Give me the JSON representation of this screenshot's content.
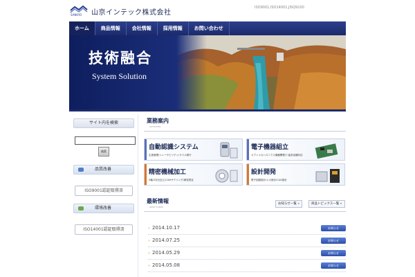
{
  "header": {
    "logo_text": "SANKYO",
    "company": "山京インテック株式会社",
    "iso": "ISO9001,ISO14001,JISQ9100"
  },
  "nav": [
    "ホーム",
    "商品情報",
    "会社情報",
    "採用情報",
    "お問い合わせ"
  ],
  "hero": {
    "title": "技術融合",
    "subtitle": "System Solution"
  },
  "sidebar": {
    "search_label": "サイト内を検索",
    "search_button": "検索",
    "quality_head": "品質改善",
    "quality_btn": "ISO9001認証取得済",
    "env_head": "環境改善",
    "env_btn": "ISO14001認証取得済"
  },
  "business": {
    "title": "業務案内",
    "title_en": "ACTIVITIES",
    "cards": [
      {
        "title": "自動認識システム",
        "sub": "生産管理/トレーサビリティ/ラベル発行",
        "accent": "#5a6fb8"
      },
      {
        "title": "電子機器組立",
        "sub": "オプトメカトロニクス機器開発/少量多品種対応",
        "accent": "#5a6fb8"
      },
      {
        "title": "精密機械加工",
        "sub": "5軸/3次元加工/CAMサテリング/精密測定",
        "accent": "#d9772b"
      },
      {
        "title": "設計開発",
        "sub": "電子回路設計/メカ設計/CAD設計",
        "accent": "#d9772b"
      }
    ]
  },
  "news": {
    "title": "最新情報",
    "title_en": "WHAT'S NEW",
    "btn_notice": "お知らせ一覧 »",
    "btn_topics": "商品トピックス一覧 »",
    "items": [
      {
        "date": "2014.10.17",
        "tag": "お知らせ"
      },
      {
        "date": "2014.07.25",
        "tag": "お知らせ"
      },
      {
        "date": "2014.05.29",
        "tag": "お知らせ"
      },
      {
        "date": "2014.05.08",
        "tag": "お知らせ"
      }
    ]
  }
}
